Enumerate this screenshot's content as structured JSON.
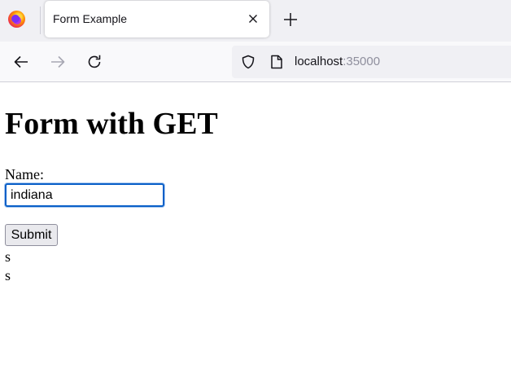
{
  "browser": {
    "tab": {
      "title": "Form Example",
      "close_icon": "close-icon"
    },
    "new_tab_icon": "plus-icon",
    "nav": {
      "back_icon": "arrow-left-icon",
      "forward_icon": "arrow-right-icon",
      "reload_icon": "reload-icon"
    },
    "url": {
      "host": "localhost",
      "port": ":35000",
      "security_icon": "shield-icon",
      "page_icon": "page-icon"
    }
  },
  "page": {
    "title": "Form with GET",
    "form": {
      "name_label": "Name:",
      "name_value": "indiana",
      "submit_label": "Submit"
    },
    "output": [
      "s",
      "s"
    ]
  },
  "colors": {
    "tabstrip_bg": "#f0f0f4",
    "navbar_bg": "#f9f9fb",
    "focus_ring": "#0a60c8",
    "port_text": "#8f8f9d"
  }
}
